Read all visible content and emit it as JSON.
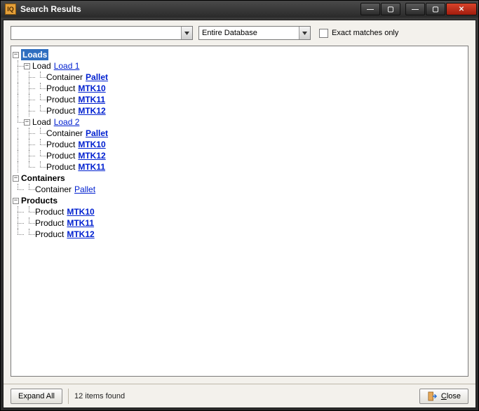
{
  "window": {
    "title": "Search Results",
    "icon_text": "IQ"
  },
  "toolbar": {
    "search_value": "",
    "scope_value": "Entire Database",
    "exact_label": "Exact matches only",
    "exact_checked": false
  },
  "tree": {
    "loads_label": "Loads",
    "load_prefix": "Load",
    "container_prefix": "Container",
    "product_prefix": "Product",
    "containers_label": "Containers",
    "products_label": "Products",
    "loads": [
      {
        "name": "Load 1",
        "children": [
          {
            "type": "Container",
            "name": "Pallet"
          },
          {
            "type": "Product",
            "name": "MTK10"
          },
          {
            "type": "Product",
            "name": "MTK11"
          },
          {
            "type": "Product",
            "name": "MTK12"
          }
        ]
      },
      {
        "name": "Load 2",
        "children": [
          {
            "type": "Container",
            "name": "Pallet"
          },
          {
            "type": "Product",
            "name": "MTK10"
          },
          {
            "type": "Product",
            "name": "MTK12"
          },
          {
            "type": "Product",
            "name": "MTK11"
          }
        ]
      }
    ],
    "containers": [
      {
        "name": "Pallet"
      }
    ],
    "products": [
      {
        "name": "MTK10"
      },
      {
        "name": "MTK11"
      },
      {
        "name": "MTK12"
      }
    ]
  },
  "bottom": {
    "expand_label": "Expand All",
    "status_text": "12 items found",
    "close_label_pre": "",
    "close_letter": "C",
    "close_rest": "lose"
  }
}
